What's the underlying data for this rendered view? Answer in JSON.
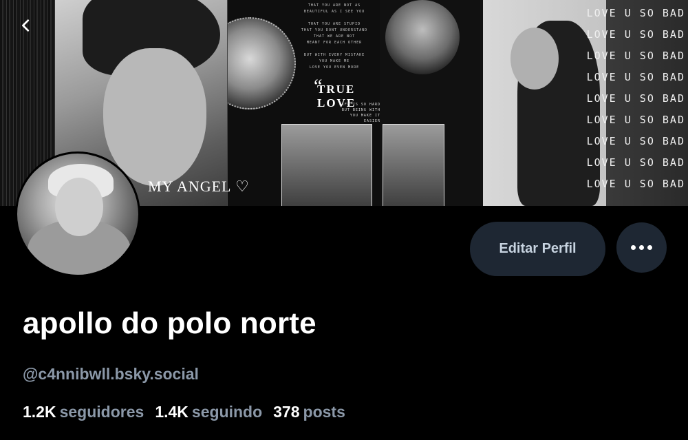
{
  "banner": {
    "lyric_top": [
      "THAT YOU ARE NOT AS",
      "BEAUTIFUL AS I SEE YOU",
      "",
      "THAT YOU ARE STUPID",
      "THAT YOU DONT UNDERSTAND",
      "THAT WE ARE NOT",
      "MEANT FOR EACH OTHER",
      "",
      "BUT WITH EVERY MISTAKE",
      "YOU MAKE ME",
      "LOVE YOU EVEN MORE"
    ],
    "quote_mark": "“",
    "true_love": "TRUE LOVE",
    "life_line1": "LIFE IS SO HARD",
    "life_line2": "BUT BEING WITH YOU MAKE IT EASIER",
    "my_angel": "MY ANGEL ♡",
    "love_lines": [
      "LOVE U SO BAD",
      "LOVE U SO BAD",
      "LOVE U SO BAD",
      "LOVE U SO BAD",
      "LOVE U SO BAD",
      "LOVE U SO BAD",
      "LOVE U SO BAD",
      "LOVE U SO BAD",
      "LOVE U SO BAD"
    ]
  },
  "nav": {
    "back_icon": "chevron-left-icon"
  },
  "profile": {
    "display_name": "apollo do polo norte",
    "handle": "@c4nnibwll.bsky.social",
    "edit_button": "Editar Perfil",
    "more_icon": "ellipsis-icon"
  },
  "stats": {
    "followers_count": "1.2K",
    "followers_label": "seguidores",
    "following_count": "1.4K",
    "following_label": "seguindo",
    "posts_count": "378",
    "posts_label": "posts"
  },
  "colors": {
    "background": "#000000",
    "button_bg": "#1e2733",
    "muted_text": "#8b98a8"
  }
}
